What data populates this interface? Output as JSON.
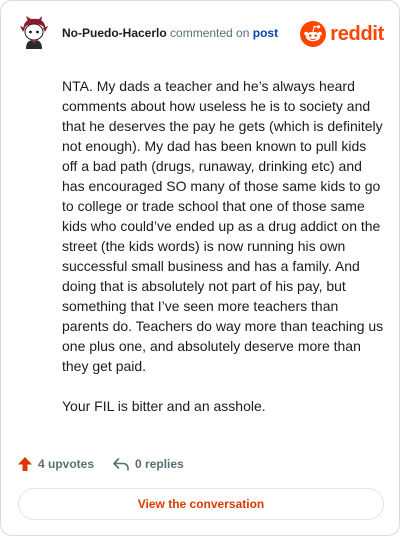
{
  "header": {
    "username": "No-Puedo-Hacerlo",
    "action_text": "commented on",
    "post_link": "post",
    "brand": "reddit"
  },
  "comment": {
    "paragraphs": [
      "NTA. My dads a teacher and he’s always heard comments about how useless he is to society and that he deserves the pay he gets (which is definitely not enough). My dad has been known to pull kids off a bad path (drugs, runaway, drinking etc) and has encouraged SO many of those same kids to go to college or trade school that one of those same kids who could’ve ended up as a drug addict on the street (the kids words) is now running his own successful small business and has a family. And doing that is absolutely not part of his pay, but something that I’ve seen more teachers than parents do. Teachers do way more than teaching us one plus one, and absolutely deserve more than they get paid.",
      "Your FIL is bitter and an asshole."
    ]
  },
  "actions": {
    "upvotes": "4 upvotes",
    "replies": "0 replies"
  },
  "footer": {
    "view_button": "View the conversation"
  },
  "icons": {
    "avatar": "avatar-icon",
    "brand": "reddit-logo-icon",
    "upvote": "upvote-arrow-icon",
    "reply": "reply-icon"
  },
  "colors": {
    "accent": "#ff4500",
    "button_text": "#d93a00",
    "link": "#0045ac",
    "muted": "#576f76",
    "text": "#1c1c1c"
  }
}
